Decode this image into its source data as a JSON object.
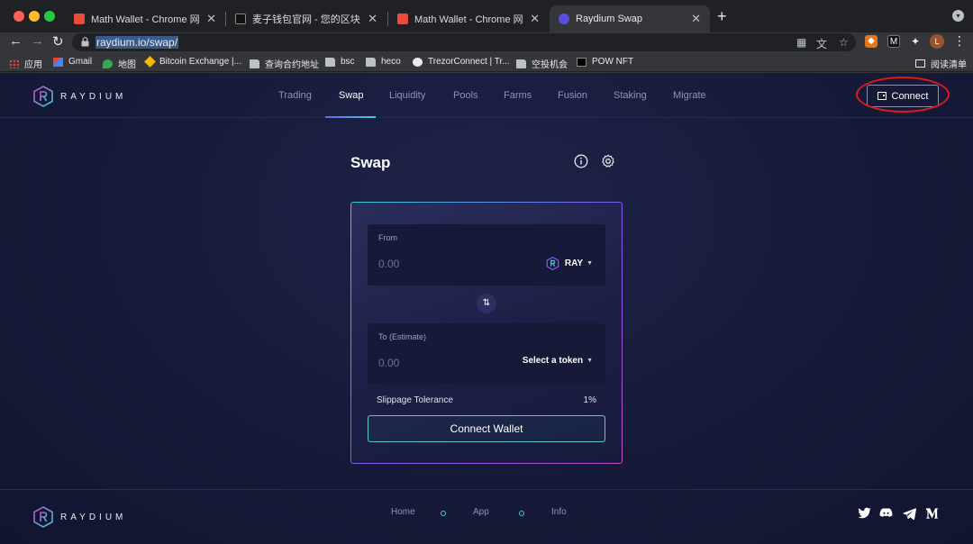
{
  "browser": {
    "tabs": [
      {
        "title": "Math Wallet - Chrome 网上应用",
        "favicon_color": "#e94b3c"
      },
      {
        "title": "麦子钱包官网 - 您的区块链应用",
        "favicon_color": "#111111"
      },
      {
        "title": "Math Wallet - Chrome 网上应用",
        "favicon_color": "#e94b3c"
      },
      {
        "title": "Raydium Swap",
        "favicon_color": "#5a4ee0"
      }
    ],
    "url": "raydium.io/swap/",
    "avatar_letter": "L",
    "bookmarks": [
      {
        "label": "应用",
        "icon": "apps-grid-icon"
      },
      {
        "label": "Gmail",
        "icon": "gmail-icon"
      },
      {
        "label": "地图",
        "icon": "maps-pin-icon"
      },
      {
        "label": "Bitcoin Exchange |...",
        "icon": "binance-icon"
      },
      {
        "label": "查询合约地址",
        "icon": "folder-icon"
      },
      {
        "label": "bsc",
        "icon": "folder-icon"
      },
      {
        "label": "heco",
        "icon": "folder-icon"
      },
      {
        "label": "TrezorConnect | Tr...",
        "icon": "trezor-icon"
      },
      {
        "label": "空投机会",
        "icon": "folder-icon"
      },
      {
        "label": "POW NFT",
        "icon": "pow-icon"
      }
    ],
    "reading_list": "阅读清单"
  },
  "app": {
    "brand": "RAYDIUM",
    "nav": [
      "Trading",
      "Swap",
      "Liquidity",
      "Pools",
      "Farms",
      "Fusion",
      "Staking",
      "Migrate"
    ],
    "active_nav": "Swap",
    "connect_label": "Connect",
    "accent_colors": {
      "cyan": "#39d0d8",
      "purple": "#7b5cf5",
      "highlight": "#e01b1b"
    }
  },
  "swap": {
    "title": "Swap",
    "from": {
      "label": "From",
      "amount": "0.00",
      "token": "RAY"
    },
    "to": {
      "label": "To (Estimate)",
      "amount": "0.00",
      "token": "Select a token"
    },
    "slippage_label": "Slippage Tolerance",
    "slippage_value": "1%",
    "action_label": "Connect Wallet"
  },
  "footer": {
    "links": [
      "Home",
      "App",
      "Info"
    ],
    "social": [
      "twitter-icon",
      "discord-icon",
      "telegram-icon",
      "medium-icon"
    ]
  }
}
